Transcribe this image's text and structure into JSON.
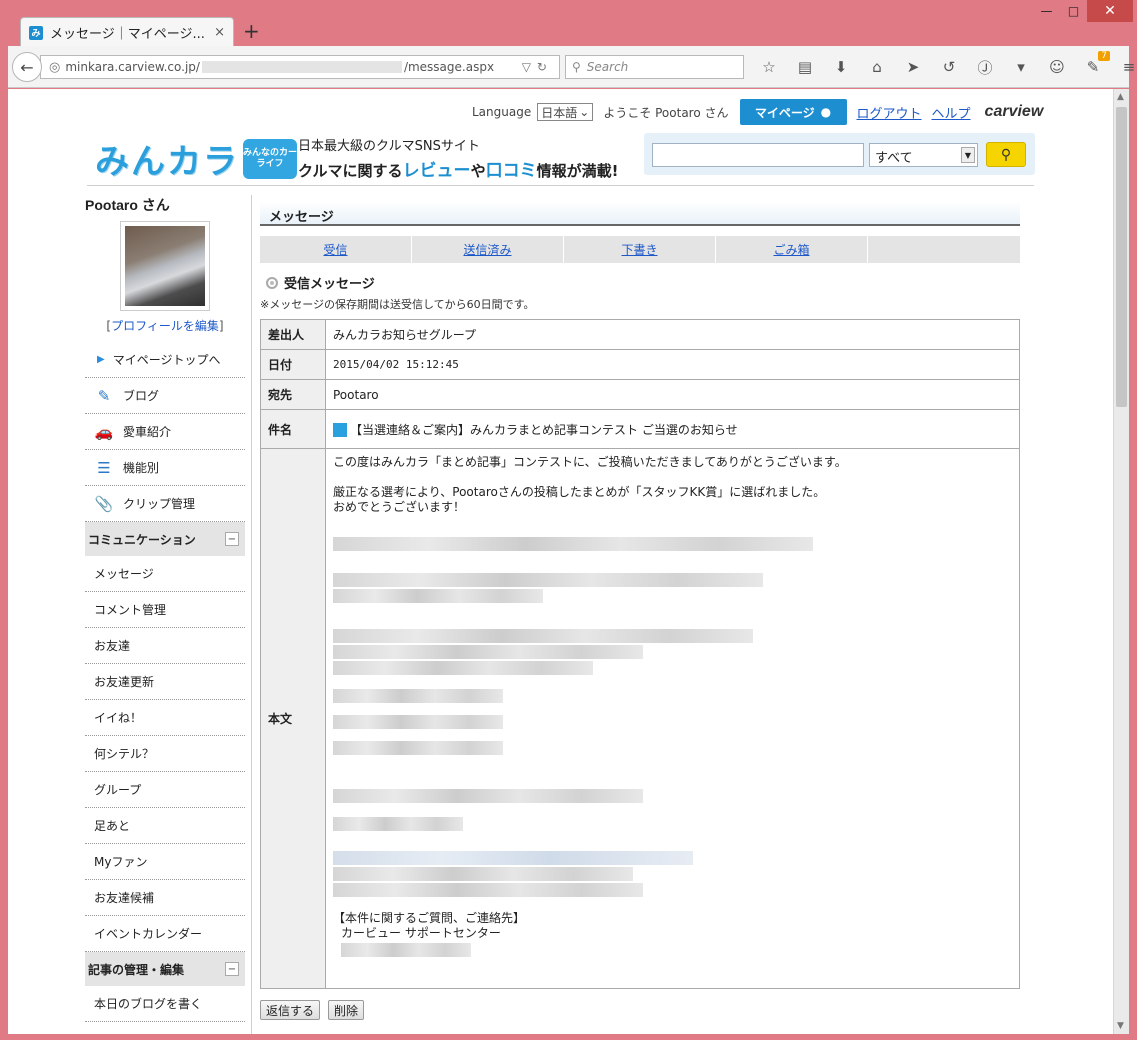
{
  "browser": {
    "tab_title": "メッセージ｜マイページ...",
    "tab_close": "×",
    "new_tab": "+",
    "url_host": "minkara.carview.co.jp/",
    "url_path": "/message.aspx",
    "search_placeholder": "Search",
    "addon_badge": "7",
    "window_buttons": {
      "minimize": "—",
      "maximize": "□",
      "close": "✕"
    }
  },
  "header": {
    "language_label": "Language",
    "language_value": "日本語",
    "welcome": "ようこそ Pootaro さん",
    "mypage_button": "マイページ",
    "logout_link": "ログアウト",
    "help_link": "ヘルプ",
    "carview_logo": "carview",
    "logo_text": "みんカラ",
    "logo_badge": "みんなのカーライフ",
    "tagline_1": "日本最大級のクルマSNSサイト",
    "tagline_2a": "クルマに関する",
    "tagline_2b": "レビュー",
    "tagline_2c": "や",
    "tagline_2d": "口コミ",
    "tagline_2e": "情報が満載!",
    "search_category": "すべて",
    "search_value": ""
  },
  "sidebar": {
    "username": "Pootaro さん",
    "profile_edit_open": "[",
    "profile_edit": "プロフィールを編集",
    "profile_edit_close": "]",
    "top_link": "マイページトップへ",
    "items": [
      {
        "label": "ブログ",
        "icon": "blog-icon",
        "glyph": "✎"
      },
      {
        "label": "愛車紹介",
        "icon": "car-icon",
        "glyph": "🚗"
      },
      {
        "label": "機能別",
        "icon": "list-icon",
        "glyph": "☰"
      },
      {
        "label": "クリップ管理",
        "icon": "clip-icon",
        "glyph": "📎"
      }
    ],
    "section_communication": "コミュニケーション",
    "communication_items": [
      "メッセージ",
      "コメント管理",
      "お友達",
      "お友達更新",
      "イイね！",
      "何シテル？",
      "グループ",
      "足あと",
      "Myファン",
      "お友達候補",
      "イベントカレンダー"
    ],
    "section_articles": "記事の管理・編集",
    "article_items": [
      "本日のブログを書く"
    ],
    "collapse_glyph": "−"
  },
  "content": {
    "section_title": "メッセージ",
    "tabs": [
      "受信",
      "送信済み",
      "下書き",
      "ごみ箱"
    ],
    "inbox_heading": "受信メッセージ",
    "retention_note": "※メッセージの保存期間は送受信してから60日間です。",
    "fields": {
      "from_label": "差出人",
      "from_value": "みんカラお知らせグループ",
      "date_label": "日付",
      "date_value": "2015/04/02 15:12:45",
      "to_label": "宛先",
      "to_value": "Pootaro",
      "subject_label": "件名",
      "subject_value": "【当選連絡＆ご案内】みんカラまとめ記事コンテスト ご当選のお知らせ",
      "body_label": "本文"
    },
    "body": {
      "line1": "この度はみんカラ「まとめ記事」コンテストに、ご投稿いただきましてありがとうございます。",
      "line2": "厳正なる選考により、Pootaroさんの投稿したまとめが「スタッフKK賞」に選ばれました。",
      "line3": "おめでとうございます！",
      "contact_heading": "【本件に関するご質問、ご連絡先】",
      "contact_name": "カービュー サポートセンター"
    },
    "reply_button": "返信する",
    "delete_button": "削除"
  }
}
